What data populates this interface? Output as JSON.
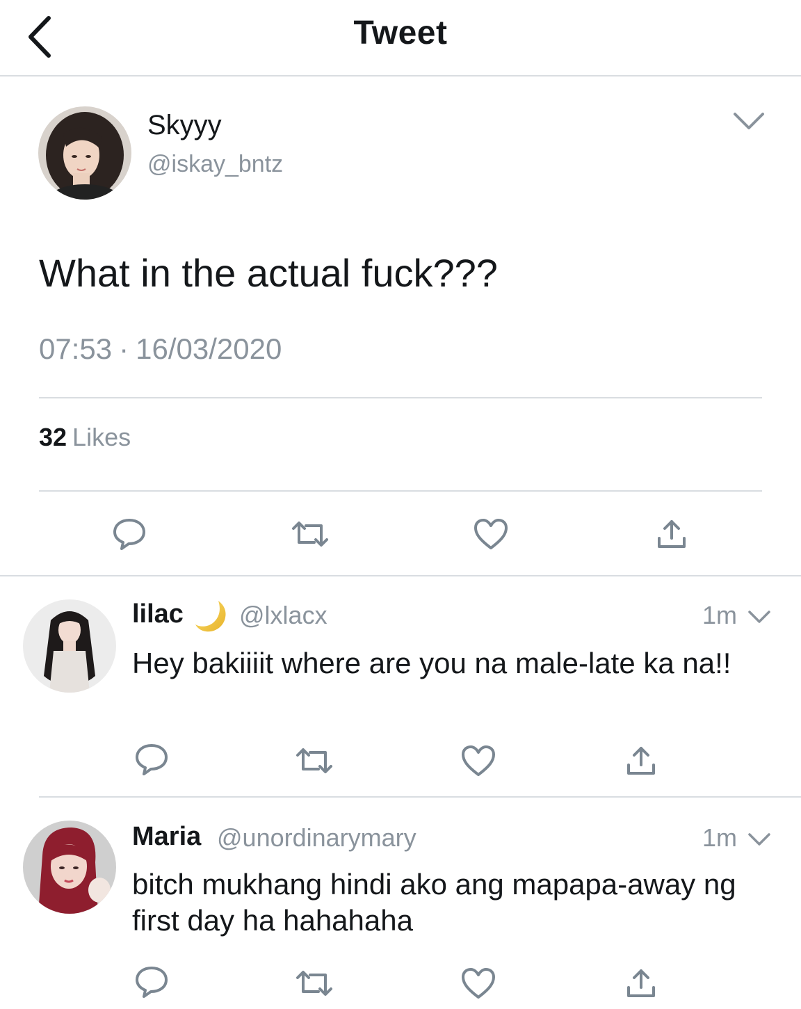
{
  "header": {
    "title": "Tweet",
    "back_icon": "chevron-left-icon"
  },
  "tweet": {
    "author_name": "Skyyy",
    "author_handle": "@iskay_bntz",
    "text": "What in the actual fuck???",
    "time": "07:53",
    "separator": "·",
    "date": "16/03/2020",
    "likes_count": "32",
    "likes_label": "Likes",
    "actions": [
      "reply-icon",
      "retweet-icon",
      "like-icon",
      "share-icon"
    ]
  },
  "replies": [
    {
      "name": "lilac",
      "name_emoji": "crescent-moon",
      "handle": "@lxlacx",
      "time": "1m",
      "text": "Hey bakiiiit where are you na male-late ka na!!"
    },
    {
      "name": "Maria",
      "handle": "@unordinarymary",
      "time": "1m",
      "text": "bitch mukhang hindi ako ang mapapa-away ng first day ha hahahaha"
    }
  ],
  "colors": {
    "text_primary": "#14171a",
    "text_secondary": "#8a939c",
    "divider": "#d9dde1",
    "icon": "#7a8691",
    "moon": "#f2c94c"
  }
}
